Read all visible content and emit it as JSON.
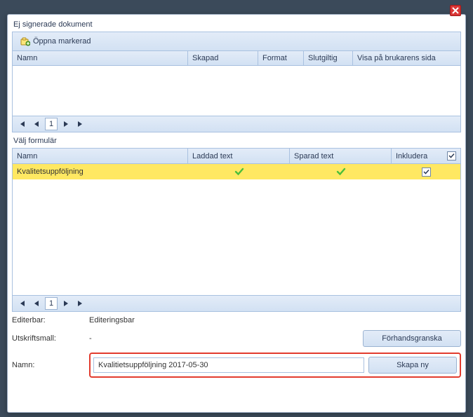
{
  "title_unsigned": "Ej signerade dokument",
  "open_marked_label": "Öppna markerad",
  "top_columns": {
    "name": "Namn",
    "created": "Skapad",
    "format": "Format",
    "final": "Slutgiltig",
    "show_user_page": "Visa på brukarens sida"
  },
  "pager_page": "1",
  "title_select_form": "Välj formulär",
  "bottom_columns": {
    "name": "Namn",
    "loaded_text": "Laddad text",
    "saved_text": "Sparad text",
    "include": "Inkludera"
  },
  "form_rows": [
    {
      "name": "Kvalitetsuppföljning",
      "loaded": true,
      "saved": true,
      "include": true,
      "selected": true
    }
  ],
  "footer": {
    "editable_label": "Editerbar:",
    "editable_value": "Editeringsbar",
    "print_template_label": "Utskriftsmall:",
    "print_template_value": "-",
    "name_label": "Namn:",
    "name_value": "Kvalitietsuppföljning 2017-05-30",
    "preview_btn": "Förhandsgranska",
    "create_btn": "Skapa ny"
  }
}
